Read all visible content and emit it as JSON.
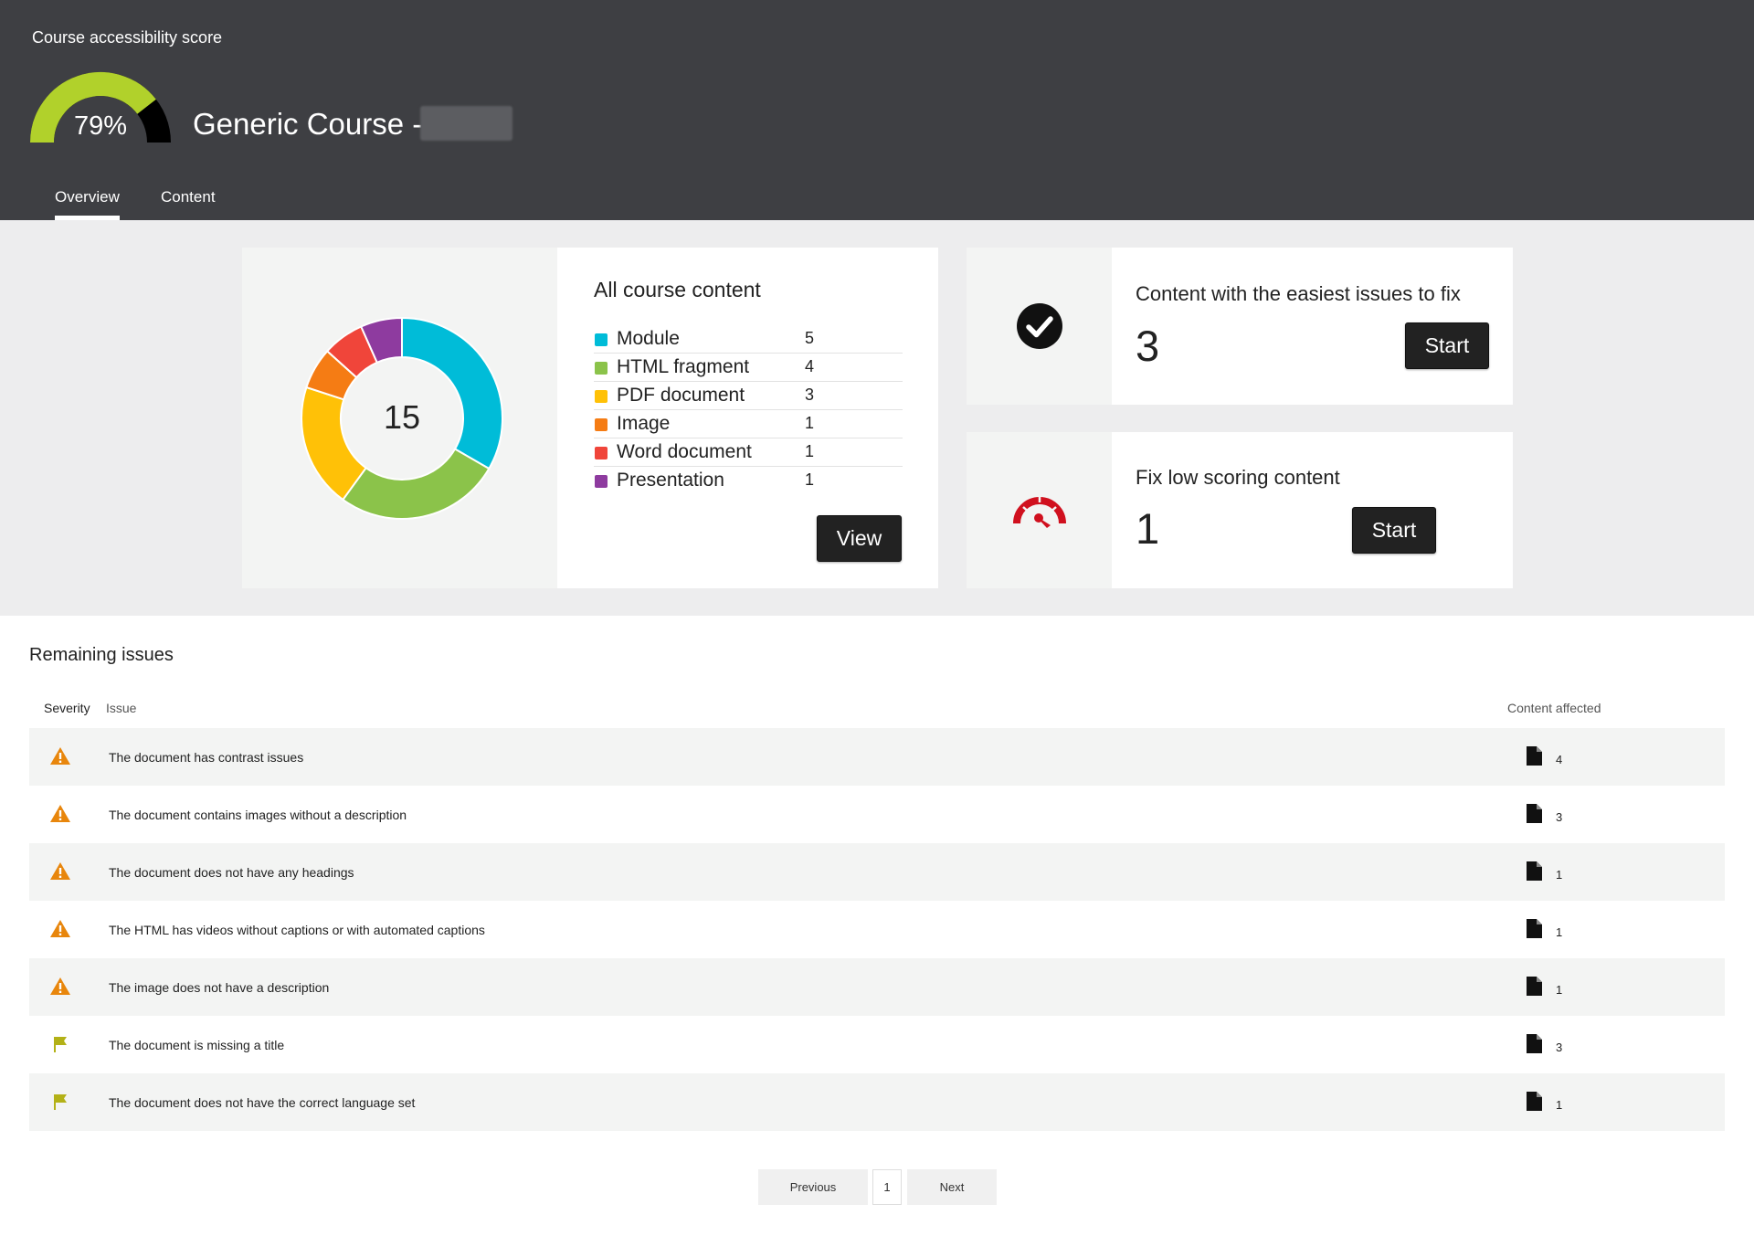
{
  "header": {
    "score_label": "Course accessibility score",
    "score_value": 79,
    "score_text": "79%",
    "course_title": "Generic Course -",
    "tabs": [
      {
        "label": "Overview",
        "active": true
      },
      {
        "label": "Content",
        "active": false
      }
    ],
    "colors": {
      "background": "#3e3f43",
      "gauge_fill": "#b1d12b",
      "gauge_rest": "#000000"
    }
  },
  "all_content": {
    "title": "All course content",
    "total": "15",
    "items": [
      {
        "name": "Module",
        "count": 5,
        "color": "#00bcd8"
      },
      {
        "name": "HTML fragment",
        "count": 4,
        "color": "#8bc34a"
      },
      {
        "name": "PDF document",
        "count": 3,
        "color": "#ffc107"
      },
      {
        "name": "Image",
        "count": 1,
        "color": "#f57c14"
      },
      {
        "name": "Word document",
        "count": 1,
        "color": "#f0453a"
      },
      {
        "name": "Presentation",
        "count": 1,
        "color": "#8e3b9f"
      }
    ],
    "view_label": "View"
  },
  "easy_fix": {
    "title": "Content with the easiest issues to fix",
    "count": "3",
    "button_label": "Start",
    "icon": "check-circle-icon"
  },
  "low_scoring": {
    "title": "Fix low scoring content",
    "count": "1",
    "button_label": "Start",
    "icon": "speedometer-icon",
    "icon_color": "#d0101e"
  },
  "issues": {
    "title": "Remaining issues",
    "columns": {
      "severity": "Severity",
      "issue": "Issue",
      "content": "Content affected"
    },
    "rows": [
      {
        "severity": "warning",
        "text": "The document has contrast issues",
        "count": "4"
      },
      {
        "severity": "warning",
        "text": "The document contains images without a description",
        "count": "3"
      },
      {
        "severity": "warning",
        "text": "The document does not have any headings",
        "count": "1"
      },
      {
        "severity": "warning",
        "text": "The HTML has videos without captions or with automated captions",
        "count": "1"
      },
      {
        "severity": "warning",
        "text": "The image does not have a description",
        "count": "1"
      },
      {
        "severity": "flag",
        "text": "The document is missing a title",
        "count": "3"
      },
      {
        "severity": "flag",
        "text": "The document does not have the correct language set",
        "count": "1"
      }
    ],
    "severity_colors": {
      "warning": "#e8860c",
      "flag": "#b3b117"
    }
  },
  "pagination": {
    "previous": "Previous",
    "page": "1",
    "next": "Next"
  }
}
